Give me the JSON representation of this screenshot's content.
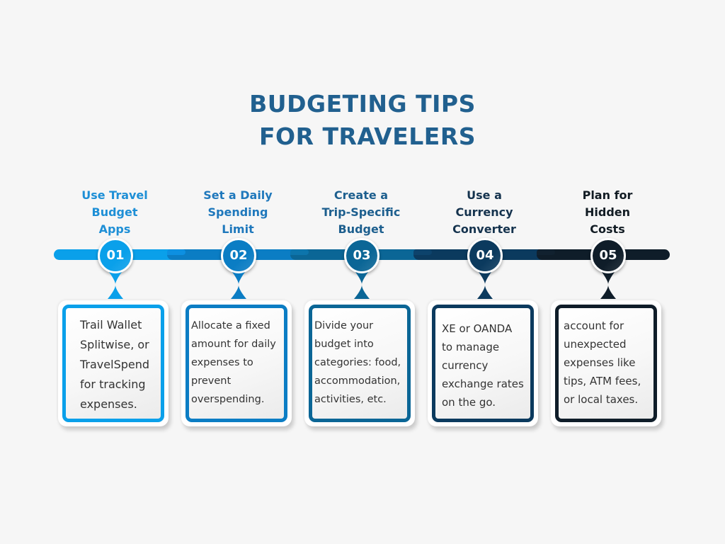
{
  "title": {
    "line1": "BUDGETING TIPS",
    "line2": "FOR TRAVELERS",
    "color": "#21608f"
  },
  "timeline": {
    "segment_colors": [
      "#0aa0ea",
      "#0b7dc4",
      "#0b6696",
      "#0b3a5e",
      "#0f1d29"
    ]
  },
  "steps": [
    {
      "number": "01",
      "heading": "Use Travel\nBudget\nApps",
      "description": "Trail Wallet\nSplitwise, or\nTravelSpend\nfor tracking\nexpenses.",
      "heading_color": "#1e8fd6",
      "accent_color": "#0aa0ea"
    },
    {
      "number": "02",
      "heading": "Set a Daily\nSpending\nLimit",
      "description": "Allocate a fixed\namount for daily\nexpenses to\nprevent\noverspending.",
      "heading_color": "#1f78bc",
      "accent_color": "#0b7dc4"
    },
    {
      "number": "03",
      "heading": "Create a\nTrip-Specific\nBudget",
      "description": "Divide your\nbudget into\ncategories: food,\naccommodation,\nactivities, etc.",
      "heading_color": "#1d5f8e",
      "accent_color": "#0b6696"
    },
    {
      "number": "04",
      "heading": "Use a\nCurrency\nConverter",
      "description": "XE or OANDA\nto manage\ncurrency\nexchange rates\non the go.",
      "heading_color": "#15334e",
      "accent_color": "#0b3a5e"
    },
    {
      "number": "05",
      "heading": "Plan for\nHidden\nCosts",
      "description": "account for\nunexpected\nexpenses like\ntips, ATM fees,\nor local taxes.",
      "heading_color": "#121c24",
      "accent_color": "#0f1d29"
    }
  ]
}
